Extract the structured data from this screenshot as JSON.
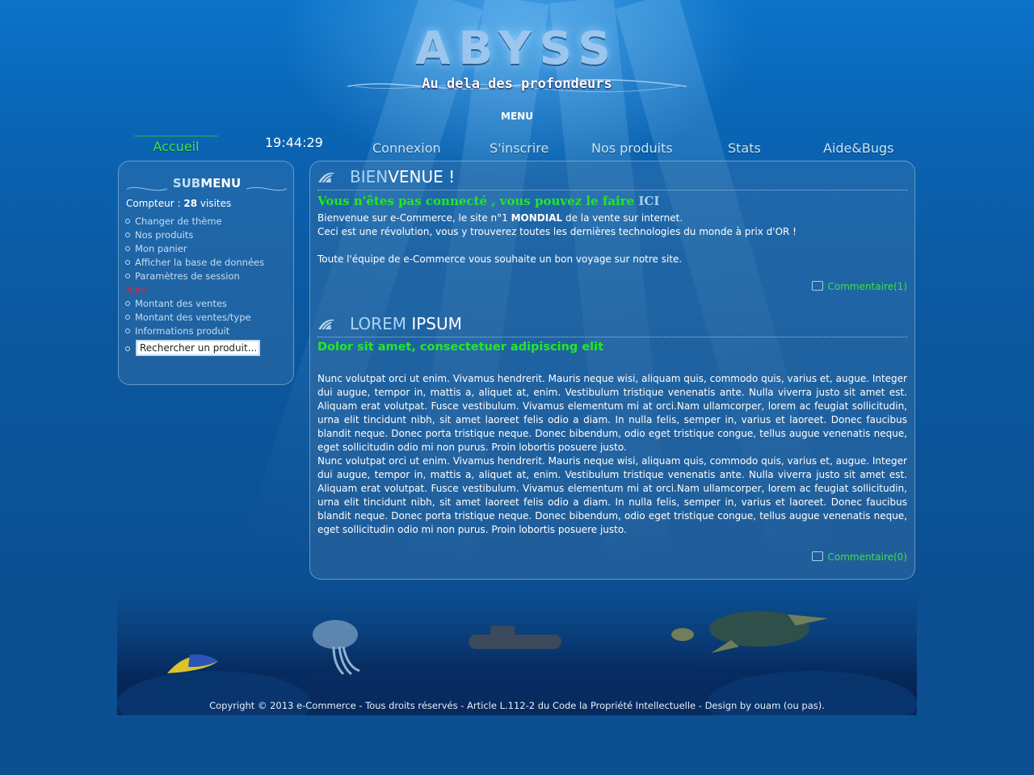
{
  "header": {
    "logo": "ABYSS",
    "tagline": "Au dela des profondeurs",
    "menu_title": "MENU"
  },
  "nav": {
    "accueil": "Accueil",
    "clock": "19:44:29",
    "connexion": "Connexion",
    "sinscrire": "S'inscrire",
    "produits": "Nos produits",
    "stats": "Stats",
    "aide": "Aide&Bugs"
  },
  "submenu": {
    "title_a": "SUB",
    "title_b": "MENU",
    "counter_label": "Compteur :",
    "counter_value": "28",
    "counter_unit": "visites",
    "items": [
      "Changer de thème",
      "Nos produits",
      "Mon panier",
      "Afficher la base de données",
      "Paramètres de session"
    ],
    "ajax_label": "Ajax",
    "ajax_items": [
      "Montant des ventes",
      "Montant des ventes/type",
      "Informations produit"
    ],
    "search_value": "Rechercher un produit..."
  },
  "welcome": {
    "title_a": "BIEN",
    "title_b": "VENUE !",
    "notice": "Vous n'êtes pas connecté , vous pouvez le faire ",
    "notice_link": "ICI",
    "line1_a": "Bienvenue sur e-Commerce, le site n°1 ",
    "line1_b": "MONDIAL",
    "line1_c": " de la vente sur internet.",
    "line2": "Ceci est une révolution, vous y trouverez toutes les dernières technologies du monde à prix d'OR !",
    "line3": "Toute l'équipe de e-Commerce vous souhaite un bon voyage sur notre site.",
    "comment": "Commentaire(1)"
  },
  "lorem": {
    "title_a": "LOREM ",
    "title_b": "IPSUM",
    "subtitle": "Dolor sit amet, consectetuer adipiscing elit",
    "paragraph1": "Nunc volutpat orci ut enim. Vivamus hendrerit. Mauris neque wisi, aliquam quis, commodo quis, varius et, augue. Integer dui augue, tempor in, mattis a, aliquet at, enim. Vestibulum tristique venenatis ante. Nulla viverra justo sit amet est. Aliquam erat volutpat. Fusce vestibulum. Vivamus elementum mi at orci.Nam ullamcorper, lorem ac feugiat sollicitudin, urna elit tincidunt nibh, sit amet laoreet felis odio a diam. In nulla felis, semper in, varius et laoreet. Donec faucibus blandit neque. Donec porta tristique neque. Donec bibendum, odio eget tristique congue, tellus augue venenatis neque, eget sollicitudin odio mi non purus. Proin lobortis posuere justo.",
    "paragraph2": "Nunc volutpat orci ut enim. Vivamus hendrerit. Mauris neque wisi, aliquam quis, commodo quis, varius et, augue. Integer dui augue, tempor in, mattis a, aliquet at, enim. Vestibulum tristique venenatis ante. Nulla viverra justo sit amet est. Aliquam erat volutpat. Fusce vestibulum. Vivamus elementum mi at orci.Nam ullamcorper, lorem ac feugiat sollicitudin, urna elit tincidunt nibh, sit amet laoreet felis odio a diam. In nulla felis, semper in, varius et laoreet. Donec faucibus blandit neque. Donec porta tristique neque. Donec bibendum, odio eget tristique congue, tellus augue venenatis neque, eget sollicitudin odio mi non purus. Proin lobortis posuere justo.",
    "comment": "Commentaire(0)"
  },
  "footer": {
    "copyright": "Copyright © 2013 e-Commerce - Tous droits réservés - Article L.112-2 du Code la Propriété Intellectuelle - Design by ouam (ou pas)."
  },
  "colors": {
    "background": "#0b4f91",
    "link_green": "#3ee04a",
    "heading_green": "#23e820",
    "ajax_red": "#e0233c"
  }
}
